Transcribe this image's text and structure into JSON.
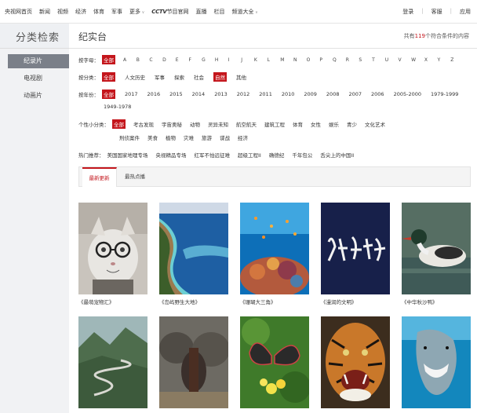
{
  "topnav": {
    "items": [
      "央视网首页",
      "新闻",
      "视频",
      "经济",
      "体育",
      "军事",
      "更多"
    ],
    "cctv_logo": "CCTV",
    "cctv_suffix": "节目官网",
    "items2": [
      "直播",
      "栏目",
      "频道大全"
    ],
    "right": [
      "登录",
      "|",
      "客服",
      "|",
      "应用"
    ]
  },
  "header": {
    "brand": "分类检索",
    "title": "纪实台",
    "count_prefix": "共有",
    "count": "119",
    "count_suffix": "个符合条件的内容"
  },
  "sidebar": {
    "items": [
      {
        "label": "纪录片",
        "active": true
      },
      {
        "label": "电视剧",
        "active": false
      },
      {
        "label": "动画片",
        "active": false
      }
    ]
  },
  "filters": {
    "letter": {
      "label": "按字母：",
      "selected": "全部",
      "options": [
        "A",
        "B",
        "C",
        "D",
        "E",
        "F",
        "G",
        "H",
        "I",
        "J",
        "K",
        "L",
        "M",
        "N",
        "O",
        "P",
        "Q",
        "R",
        "S",
        "T",
        "U",
        "V",
        "W",
        "X",
        "Y",
        "Z"
      ]
    },
    "category": {
      "label": "按分类：",
      "selected": "全部",
      "options": [
        "人文历史",
        "军事",
        "探索",
        "社会",
        "自然",
        "其他"
      ],
      "highlighted": "自然"
    },
    "year": {
      "label": "按年份：",
      "selected": "全部",
      "options": [
        "2017",
        "2016",
        "2015",
        "2014",
        "2013",
        "2012",
        "2011",
        "2010",
        "2009",
        "2008",
        "2007",
        "2006",
        "2005-2000",
        "1979-1999"
      ],
      "options_row2": [
        "1949-1978"
      ]
    },
    "subcat": {
      "label": "个性小分类：",
      "selected": "全部",
      "options": [
        "考古发现",
        "宇宙奥秘",
        "动物",
        "灵异未知",
        "航空航天",
        "建筑工程",
        "体育",
        "女性",
        "娱乐",
        "青少",
        "文化艺术"
      ],
      "options_row2": [
        "刑侦案件",
        "美食",
        "植物",
        "灾难",
        "旅游",
        "谍战",
        "经济"
      ]
    },
    "hot": {
      "label": "热门推荐：",
      "options": [
        "美国国家地理专场",
        "央视精品专场",
        "红军不怕远征难",
        "超级工程II",
        "确德纪",
        "千年包公",
        "舌尖上的中国II"
      ]
    }
  },
  "tabs": {
    "active": "最新更新",
    "other": "最热点播"
  },
  "grid": {
    "row1": [
      {
        "caption": "《最萌宠物汇》",
        "icon": "cat-glasses-thumb"
      },
      {
        "caption": "《岛屿野生大地》",
        "icon": "island-aerial-thumb"
      },
      {
        "caption": "《珊瑚大三角》",
        "icon": "coral-reef-thumb"
      },
      {
        "caption": "《漫润的文明》",
        "icon": "calligraphy-thumb"
      },
      {
        "caption": "《中华秋沙鸭》",
        "icon": "merganser-duck-thumb"
      }
    ],
    "row2": [
      {
        "icon": "mountain-road-thumb"
      },
      {
        "icon": "elephant-herd-thumb"
      },
      {
        "icon": "butterfly-flower-thumb"
      },
      {
        "icon": "tiger-thumb"
      },
      {
        "icon": "shark-thumb"
      }
    ]
  },
  "colors": {
    "accent": "#c4161c",
    "sidebar_active": "#7b8089",
    "sidebar_bg": "#f1f2f4"
  }
}
